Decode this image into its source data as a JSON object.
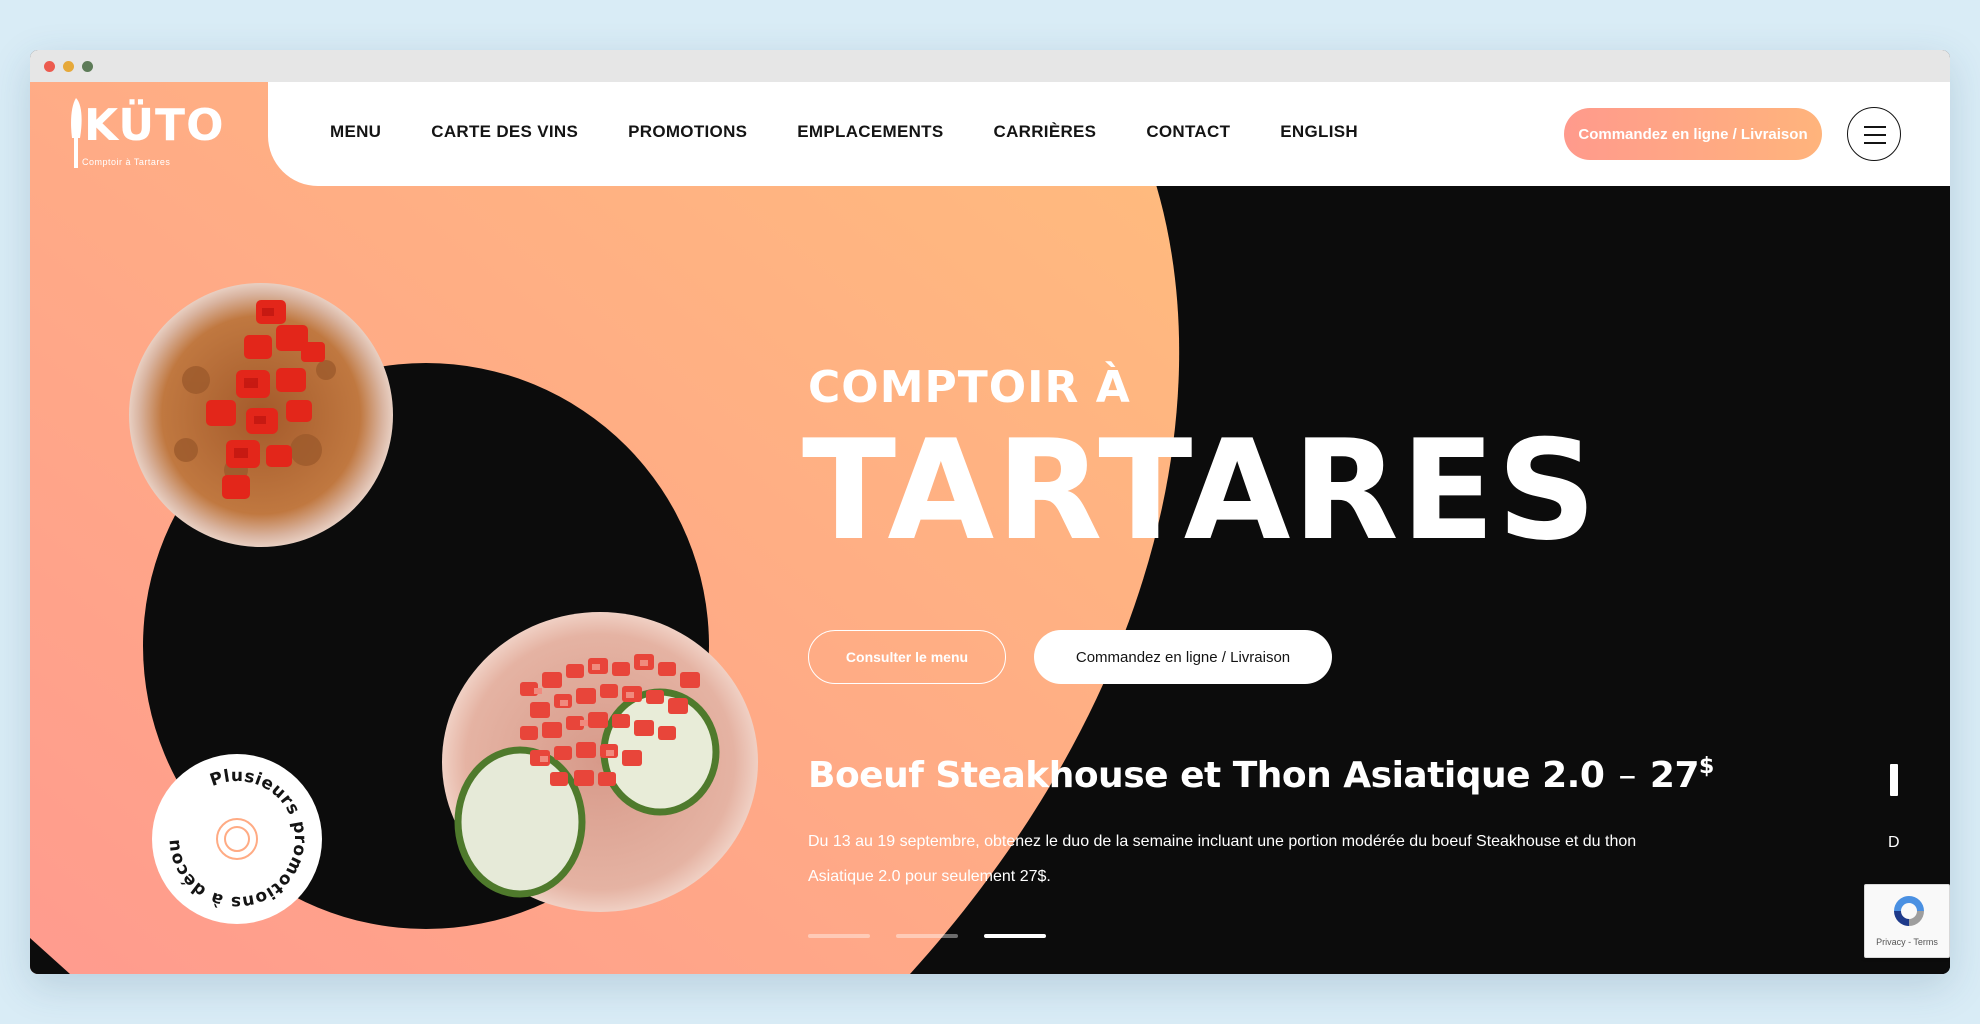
{
  "logo": {
    "name": "KÜTO",
    "tagline": "Comptoir à Tartares"
  },
  "nav": {
    "items": [
      "MENU",
      "CARTE DES VINS",
      "PROMOTIONS",
      "EMPLACEMENTS",
      "CARRIÈRES",
      "CONTACT",
      "ENGLISH"
    ],
    "order_label": "Commandez en ligne / Livraison",
    "menu_icon": "hamburger-icon"
  },
  "hero": {
    "subtitle": "COMPTOIR À",
    "title": "TARTARES",
    "menu_button": "Consulter le menu",
    "order_button": "Commandez en ligne / Livraison"
  },
  "promo": {
    "title": "Boeuf Steakhouse et Thon Asiatique 2.0",
    "dash": "–",
    "price": "27",
    "currency": "$",
    "description": "Du 13 au 19 septembre, obtenez le duo de la semaine incluant une portion modérée du boeuf Steakhouse et du thon Asiatique 2.0 pour seulement 27$.",
    "next_initial": "D"
  },
  "slider": {
    "count": 3,
    "active": 3
  },
  "badge": {
    "text": "Plusieurs promotions à découvrir !"
  },
  "recaptcha": {
    "terms": "Privacy - Terms"
  },
  "colors": {
    "peach": "#ffab84",
    "coral": "#ff9a8c",
    "dark": "#0c0c0c",
    "white": "#ffffff"
  }
}
